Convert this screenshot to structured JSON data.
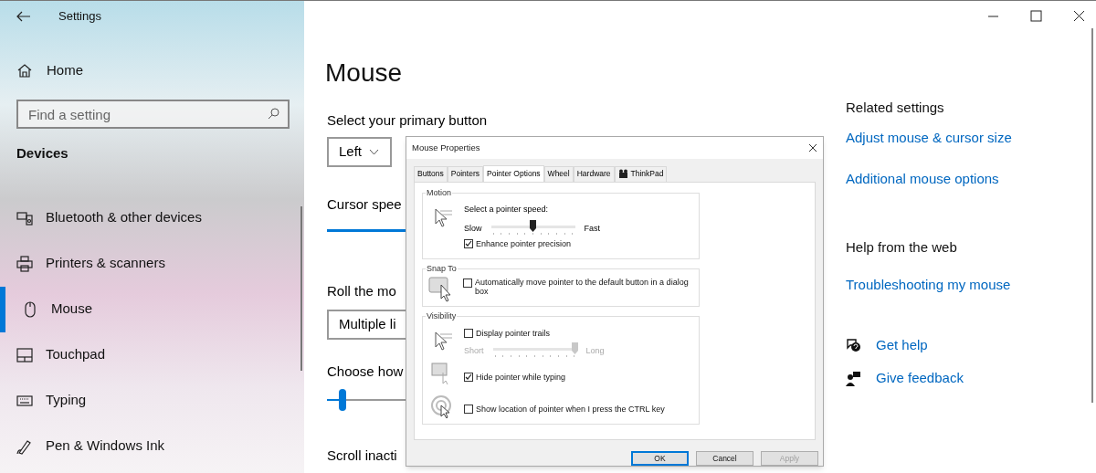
{
  "window": {
    "title": "Settings"
  },
  "sidebar": {
    "home": "Home",
    "search_placeholder": "Find a setting",
    "section": "Devices",
    "items": [
      {
        "label": "Bluetooth & other devices",
        "kind": "bluetooth",
        "selected": false
      },
      {
        "label": "Printers & scanners",
        "kind": "printer",
        "selected": false
      },
      {
        "label": "Mouse",
        "kind": "mouse",
        "selected": true
      },
      {
        "label": "Touchpad",
        "kind": "touchpad",
        "selected": false
      },
      {
        "label": "Typing",
        "kind": "keyboard",
        "selected": false
      },
      {
        "label": "Pen & Windows Ink",
        "kind": "pen",
        "selected": false
      }
    ]
  },
  "main": {
    "title": "Mouse",
    "primary_label": "Select your primary button",
    "primary_value": "Left",
    "cursor_label": "Cursor spee",
    "roll_label": "Roll the mo",
    "roll_value": "Multiple li",
    "choose_label": "Choose how",
    "choose_slider": {
      "level": 0.2
    },
    "scroll_label": "Scroll inacti"
  },
  "related": {
    "title": "Related settings",
    "links": [
      "Adjust mouse & cursor size",
      "Additional mouse options"
    ]
  },
  "help": {
    "title": "Help from the web",
    "link": "Troubleshooting my mouse"
  },
  "support": [
    {
      "kind": "help",
      "label": "Get help"
    },
    {
      "kind": "feedback",
      "label": "Give feedback"
    }
  ],
  "dialog": {
    "title": "Mouse Properties",
    "tabs": [
      {
        "label": "Buttons",
        "selected": false,
        "kind": "plain"
      },
      {
        "label": "Pointers",
        "selected": false,
        "kind": "plain"
      },
      {
        "label": "Pointer Options",
        "selected": true,
        "kind": "plain"
      },
      {
        "label": "Wheel",
        "selected": false,
        "kind": "plain"
      },
      {
        "label": "Hardware",
        "selected": false,
        "kind": "plain"
      },
      {
        "label": "ThinkPad",
        "selected": false,
        "kind": "icon"
      }
    ],
    "motion": {
      "title": "Motion",
      "speed_label": "Select a pointer speed:",
      "slow": "Slow",
      "fast": "Fast",
      "level": 0.49,
      "enhance": {
        "label": "Enhance pointer precision",
        "checked": true
      }
    },
    "snap": {
      "title": "Snap To",
      "option": {
        "label": "Automatically move pointer to the default button in a dialog box",
        "checked": false
      }
    },
    "visibility": {
      "title": "Visibility",
      "trails": {
        "label": "Display pointer trails",
        "checked": false
      },
      "short": "Short",
      "long": "Long",
      "trails_slider": {
        "level": 1
      },
      "hide": {
        "label": "Hide pointer while typing",
        "checked": true
      },
      "ctrl": {
        "label": "Show location of pointer when I press the CTRL key",
        "checked": false
      }
    },
    "buttons": [
      {
        "label": "OK",
        "kind": "default",
        "disabled": false
      },
      {
        "label": "Cancel",
        "kind": "normal",
        "disabled": false
      },
      {
        "label": "Apply",
        "kind": "normal",
        "disabled": true
      }
    ]
  }
}
